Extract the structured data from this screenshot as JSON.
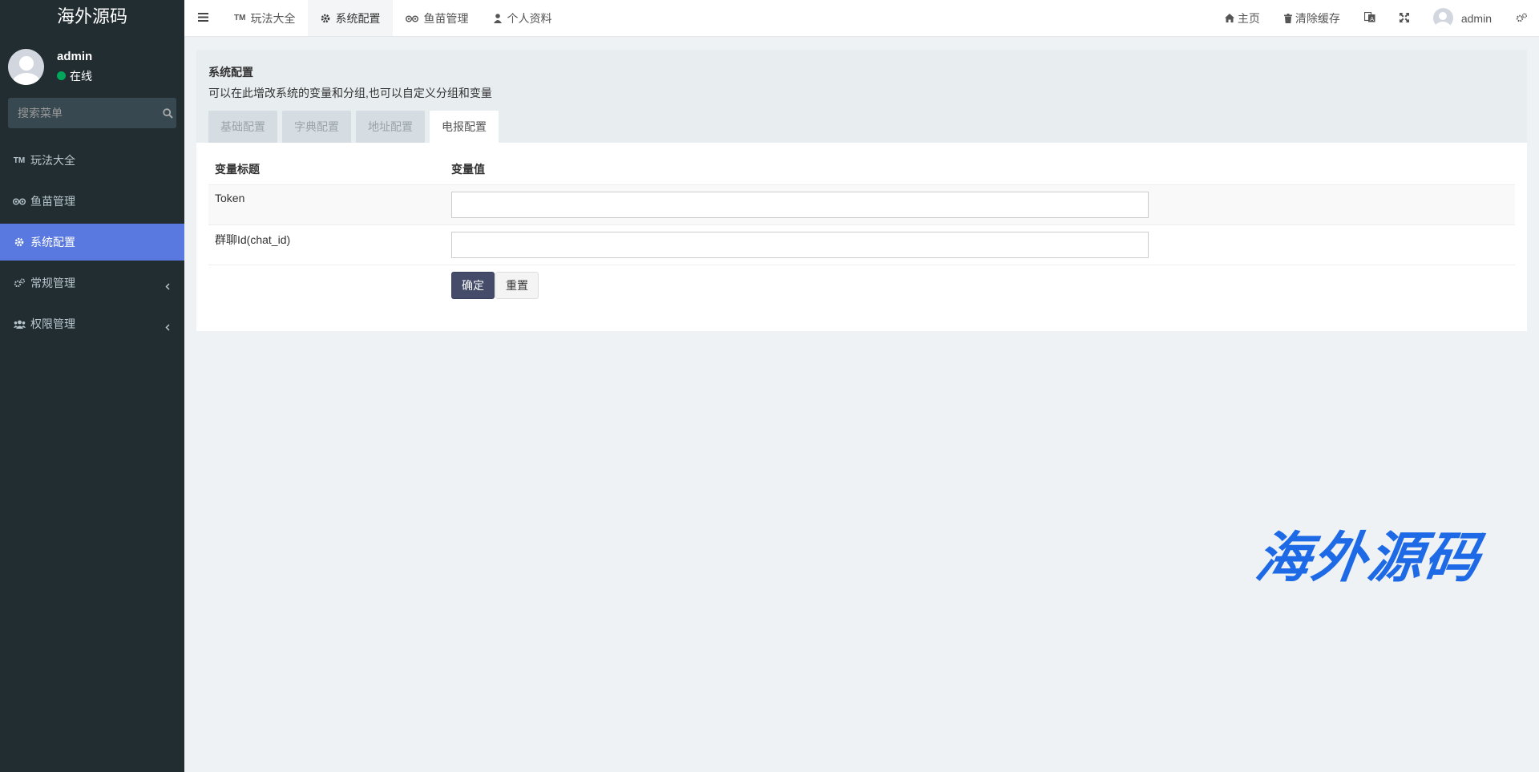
{
  "brand": "海外源码",
  "user": {
    "name": "admin",
    "status": "在线"
  },
  "search": {
    "placeholder": "搜索菜单"
  },
  "sidebar": {
    "items": [
      {
        "label": "玩法大全",
        "icon": "trademark-icon"
      },
      {
        "label": "鱼苗管理",
        "icon": "tripadvisor-icon"
      },
      {
        "label": "系统配置",
        "icon": "gear-icon",
        "active": true
      },
      {
        "label": "常规管理",
        "icon": "gears-icon"
      },
      {
        "label": "权限管理",
        "icon": "users-icon"
      }
    ]
  },
  "navbar": {
    "tabs": [
      {
        "label": "玩法大全"
      },
      {
        "label": "系统配置",
        "active": true
      },
      {
        "label": "鱼苗管理"
      },
      {
        "label": "个人资料"
      }
    ],
    "right": {
      "home": "主页",
      "clear_cache": "清除缓存",
      "user": "admin"
    }
  },
  "panel": {
    "title": "系统配置",
    "description": "可以在此增改系统的变量和分组,也可以自定义分组和变量",
    "tabs": [
      "基础配置",
      "字典配置",
      "地址配置",
      "电报配置"
    ],
    "active_tab": "电报配置"
  },
  "table": {
    "headers": [
      "变量标题",
      "变量值"
    ],
    "rows": [
      {
        "label": "Token",
        "value": ""
      },
      {
        "label": "群聊Id(chat_id)",
        "value": ""
      }
    ]
  },
  "buttons": {
    "submit": "确定",
    "reset": "重置"
  },
  "watermark": "海外源码",
  "colors": {
    "sidebar_bg": "#222d32",
    "active_menu": "#5a79e0",
    "primary_button": "#444c69",
    "watermark": "#1e6ae6"
  }
}
